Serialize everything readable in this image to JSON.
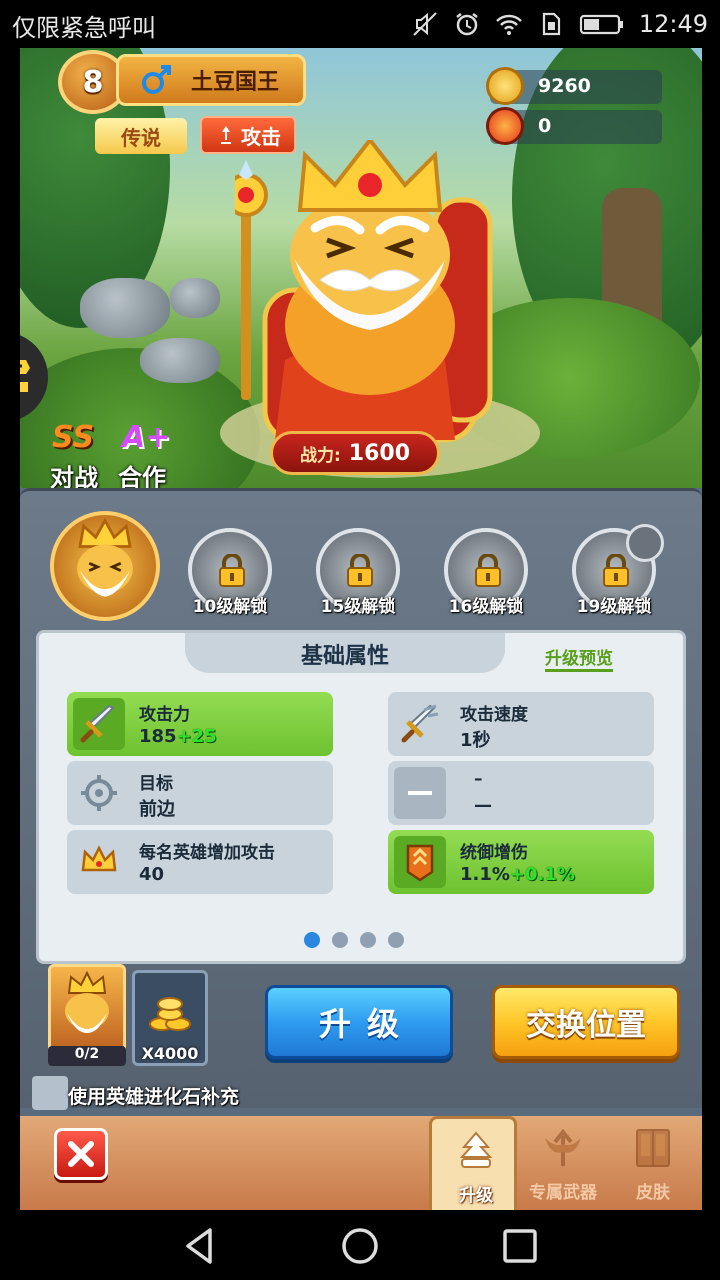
{
  "statusbar": {
    "carrier": "仅限紧急呼叫",
    "time": "12:49",
    "icons": [
      "mute-icon",
      "alarm-icon",
      "wifi-icon",
      "sim-icon",
      "battery-icon"
    ]
  },
  "hero": {
    "level": "8",
    "name": "土豆国王",
    "gender_icon": "male-icon",
    "rarity_tag": "传说",
    "role_tag": "攻击",
    "power_label": "战力:",
    "power_value": "1600",
    "mode_badges": [
      "SS",
      "A+"
    ],
    "mode_labels": [
      "对战",
      "合作"
    ]
  },
  "currency": {
    "gold": "9260",
    "fire": "0"
  },
  "skills": [
    {
      "label": "10级解锁",
      "icon": "lock-icon"
    },
    {
      "label": "15级解锁",
      "icon": "lock-icon"
    },
    {
      "label": "16级解锁",
      "icon": "lock-icon"
    },
    {
      "label": "19级解锁",
      "icon": "lock-icon"
    }
  ],
  "attributes": {
    "title": "基础属性",
    "preview_link": "升级预览",
    "items": [
      {
        "label": "攻击力",
        "value": "185",
        "bonus": "+25",
        "icon": "sword-icon",
        "highlight": true
      },
      {
        "label": "攻击速度",
        "value": "1秒",
        "bonus": "",
        "icon": "speed-sword-icon",
        "highlight": false
      },
      {
        "label": "目标",
        "value": "前边",
        "bonus": "",
        "icon": "crosshair-icon",
        "highlight": false
      },
      {
        "label": "–",
        "value": "—",
        "bonus": "",
        "icon": "dash-icon",
        "highlight": false
      },
      {
        "label": "每名英雄增加攻击",
        "value": "40",
        "bonus": "",
        "icon": "crown-icon",
        "highlight": false
      },
      {
        "label": "统御增伤",
        "value": "1.1%",
        "bonus": "+0.1%",
        "icon": "banner-icon",
        "highlight": true
      }
    ],
    "page_count": 4,
    "active_page": 0
  },
  "actions": {
    "evo_count": "0/2",
    "coin_count": "X4000",
    "upgrade_label": "升级",
    "swap_label": "交换位置",
    "checkbox_label": "使用英雄进化石补充"
  },
  "tabs": [
    {
      "label": "升级",
      "icon": "upgrade-icon",
      "active": true
    },
    {
      "label": "专属武器",
      "icon": "weapon-icon",
      "active": false
    },
    {
      "label": "皮肤",
      "icon": "wardrobe-icon",
      "active": false
    }
  ],
  "colors": {
    "upgrade_blue": "#2f9cf0",
    "swap_yellow": "#ffc628",
    "bonus_green": "#2ee32e",
    "panel_slate": "#5a6b7d"
  }
}
